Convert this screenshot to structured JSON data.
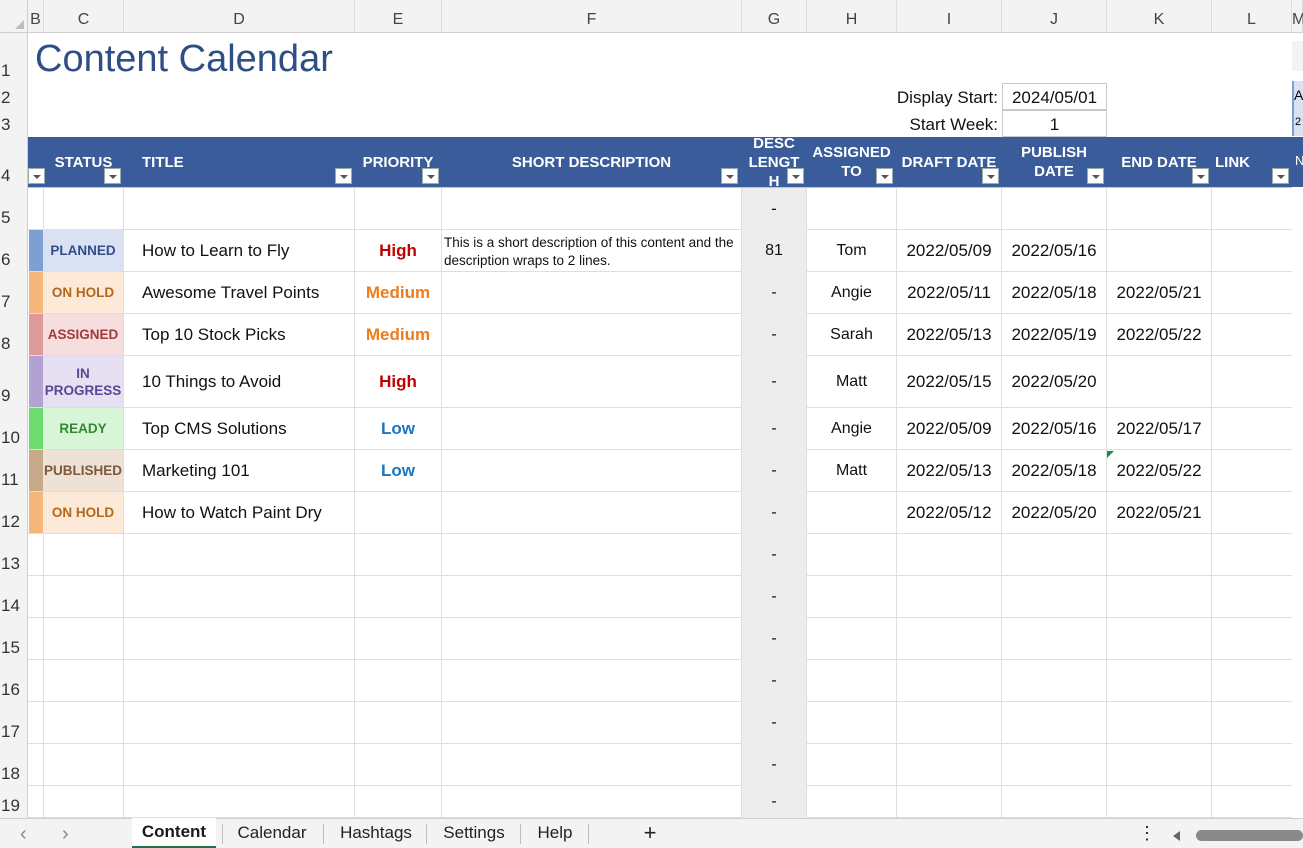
{
  "columns": [
    "B",
    "C",
    "D",
    "E",
    "F",
    "G",
    "H",
    "I",
    "J",
    "K",
    "L",
    "M"
  ],
  "rows": [
    "1",
    "2",
    "3",
    "4",
    "5",
    "6",
    "7",
    "8",
    "9",
    "10",
    "11",
    "12",
    "13",
    "14",
    "15",
    "16",
    "17",
    "18",
    "19"
  ],
  "title": "Content Calendar",
  "display_start_label": "Display Start:",
  "display_start_value": "2024/05/01",
  "start_week_label": "Start Week:",
  "start_week_value": "1",
  "headers": {
    "status": "STATUS",
    "title": "TITLE",
    "priority": "PRIORITY",
    "short_description": "SHORT DESCRIPTION",
    "desc_length": "DESC LENGT H",
    "assigned_to": "ASSIGNED TO",
    "draft_date": "DRAFT DATE",
    "publish_date": "PUBLISH DATE",
    "end_date": "END DATE",
    "link": "LINK"
  },
  "row5_desc_length": "-",
  "tasks": [
    {
      "status": "PLANNED",
      "status_color": "#7e9fd1",
      "status_bg": "#d9e1f2",
      "status_fg": "#2e4e85",
      "title": "How to Learn to Fly",
      "priority": "High",
      "priority_color": "#c00000",
      "description": "This is a short description of this content and the description wraps to 2 lines.",
      "desc_length": "81",
      "assigned": "Tom",
      "draft": "2022/05/09",
      "publish": "2022/05/16",
      "end": ""
    },
    {
      "status": "ON HOLD",
      "status_color": "#f4b67a",
      "status_bg": "#fde9d7",
      "status_fg": "#b4661b",
      "title": "Awesome Travel Points",
      "priority": "Medium",
      "priority_color": "#f07c19",
      "description": "",
      "desc_length": "-",
      "assigned": "Angie",
      "draft": "2022/05/11",
      "publish": "2022/05/18",
      "end": "2022/05/21"
    },
    {
      "status": "ASSIGNED",
      "status_color": "#dc9a9a",
      "status_bg": "#f6dede",
      "status_fg": "#a33a3a",
      "title": "Top 10 Stock Picks",
      "priority": "Medium",
      "priority_color": "#f07c19",
      "description": "",
      "desc_length": "-",
      "assigned": "Sarah",
      "draft": "2022/05/13",
      "publish": "2022/05/19",
      "end": "2022/05/22"
    },
    {
      "status": "IN PROGRESS",
      "status_color": "#b2a1d3",
      "status_bg": "#e6e0f2",
      "status_fg": "#5b4596",
      "title": "10 Things to Avoid",
      "priority": "High",
      "priority_color": "#c00000",
      "description": "",
      "desc_length": "-",
      "assigned": "Matt",
      "draft": "2022/05/15",
      "publish": "2022/05/20",
      "end": ""
    },
    {
      "status": "READY",
      "status_color": "#6edb6e",
      "status_bg": "#d8f5d8",
      "status_fg": "#2f8a2f",
      "title": "Top CMS Solutions",
      "priority": "Low",
      "priority_color": "#1a75c2",
      "description": "",
      "desc_length": "-",
      "assigned": "Angie",
      "draft": "2022/05/09",
      "publish": "2022/05/16",
      "end": "2022/05/17"
    },
    {
      "status": "PUBLISHED",
      "status_color": "#c7a98a",
      "status_bg": "#eee2d6",
      "status_fg": "#7a5a3a",
      "title": "Marketing 101",
      "priority": "Low",
      "priority_color": "#1a75c2",
      "description": "",
      "desc_length": "-",
      "assigned": "Matt",
      "draft": "2022/05/13",
      "publish": "2022/05/18",
      "end": "2022/05/22"
    },
    {
      "status": "ON HOLD",
      "status_color": "#f4b67a",
      "status_bg": "#fde9d7",
      "status_fg": "#b4661b",
      "title": "How to Watch Paint Dry",
      "priority": "",
      "priority_color": "#111111",
      "description": "",
      "desc_length": "-",
      "assigned": "",
      "draft": "2022/05/12",
      "publish": "2022/05/20",
      "end": "2022/05/21"
    }
  ],
  "empty_desc_length": [
    "-",
    "-",
    "-",
    "-",
    "-",
    "-",
    "-"
  ],
  "tabs": [
    "Content",
    "Calendar",
    "Hashtags",
    "Settings",
    "Help"
  ],
  "active_tab": "Content",
  "add_sheet_label": "+",
  "peek_right": [
    "A",
    "2",
    "N"
  ]
}
